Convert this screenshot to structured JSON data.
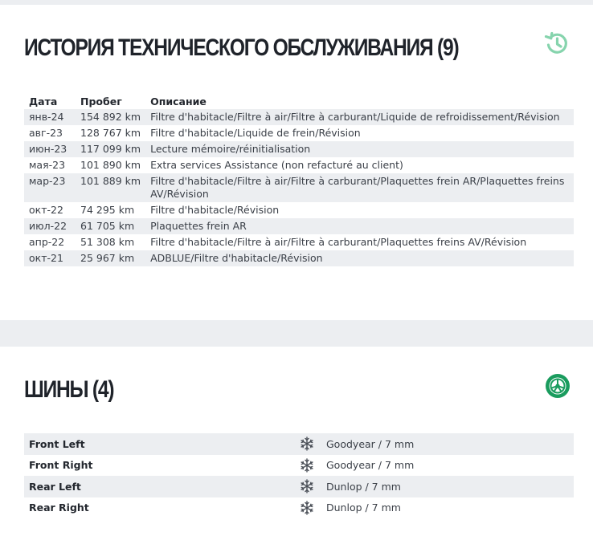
{
  "history": {
    "title": "ИСТОРИЯ ТЕХНИЧЕСКОГО ОБСЛУЖИВАНИЯ (9)",
    "icon": "history-icon",
    "accent_color": "#7fd1a8",
    "columns": {
      "date": "Дата",
      "mileage": "Пробег",
      "description": "Описание"
    },
    "rows": [
      {
        "date": "янв-24",
        "mileage": "154 892 km",
        "description": "Filtre d'habitacle/Filtre à air/Filtre à carburant/Liquide de refroidissement/Révision"
      },
      {
        "date": "авг-23",
        "mileage": "128 767 km",
        "description": "Filtre d'habitacle/Liquide de frein/Révision"
      },
      {
        "date": "июн-23",
        "mileage": "117 099 km",
        "description": "Lecture mémoire/réinitialisation"
      },
      {
        "date": "мая-23",
        "mileage": "101 890 km",
        "description": "Extra services Assistance (non refacturé au client)"
      },
      {
        "date": "мар-23",
        "mileage": "101 889 km",
        "description": "Filtre d'habitacle/Filtre à air/Filtre à carburant/Plaquettes frein AR/Plaquettes freins AV/Révision"
      },
      {
        "date": "окт-22",
        "mileage": "74 295 km",
        "description": "Filtre d'habitacle/Révision"
      },
      {
        "date": "июл-22",
        "mileage": "61 705 km",
        "description": "Plaquettes frein AR"
      },
      {
        "date": "апр-22",
        "mileage": "51 308 km",
        "description": "Filtre d'habitacle/Filtre à air/Filtre à carburant/Plaquettes freins AV/Révision"
      },
      {
        "date": "окт-21",
        "mileage": "25 967 km",
        "description": "ADBLUE/Filtre d'habitacle/Révision"
      }
    ]
  },
  "tires": {
    "title": "ШИНЫ (4)",
    "icon": "tire-icon",
    "accent_color": "#1a9c5e",
    "rows": [
      {
        "position": "Front Left",
        "season_icon": "snowflake-icon",
        "value": "Goodyear / 7 mm"
      },
      {
        "position": "Front Right",
        "season_icon": "snowflake-icon",
        "value": "Goodyear / 7 mm"
      },
      {
        "position": "Rear Left",
        "season_icon": "snowflake-icon",
        "value": "Dunlop / 7 mm"
      },
      {
        "position": "Rear Right",
        "season_icon": "snowflake-icon",
        "value": "Dunlop / 7 mm"
      }
    ]
  }
}
